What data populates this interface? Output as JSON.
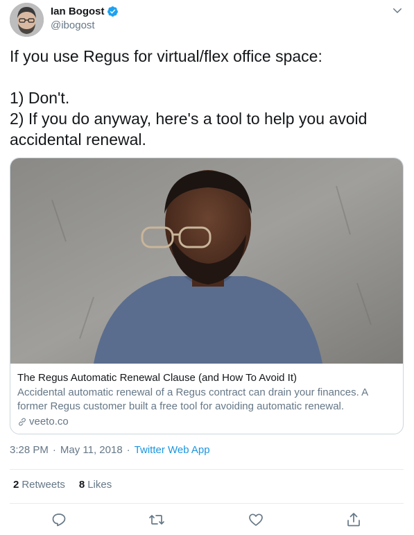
{
  "author": {
    "name": "Ian Bogost",
    "handle": "@ibogost",
    "verified": true,
    "avatar_icon": "avatar-icon"
  },
  "tweet": {
    "text": "If you use Regus for virtual/flex office space:\n\n1) Don't.\n2) If you do anyway, here's a tool to help you avoid accidental renewal."
  },
  "card": {
    "title": "The Regus Automatic Renewal Clause (and How To Avoid It)",
    "description": "Accidental automatic renewal of a Regus contract can drain your finances. A former Regus customer built a free tool for avoiding automatic renewal.",
    "domain": "veeto.co"
  },
  "meta": {
    "time": "3:28 PM",
    "date": "May 11, 2018",
    "separator": "·",
    "source": "Twitter Web App"
  },
  "stats": {
    "retweets_count": "2",
    "retweets_label": "Retweets",
    "likes_count": "8",
    "likes_label": "Likes"
  },
  "colors": {
    "accent": "#1b95e0",
    "secondary_text": "#657786",
    "divider": "#e6ecf0"
  }
}
